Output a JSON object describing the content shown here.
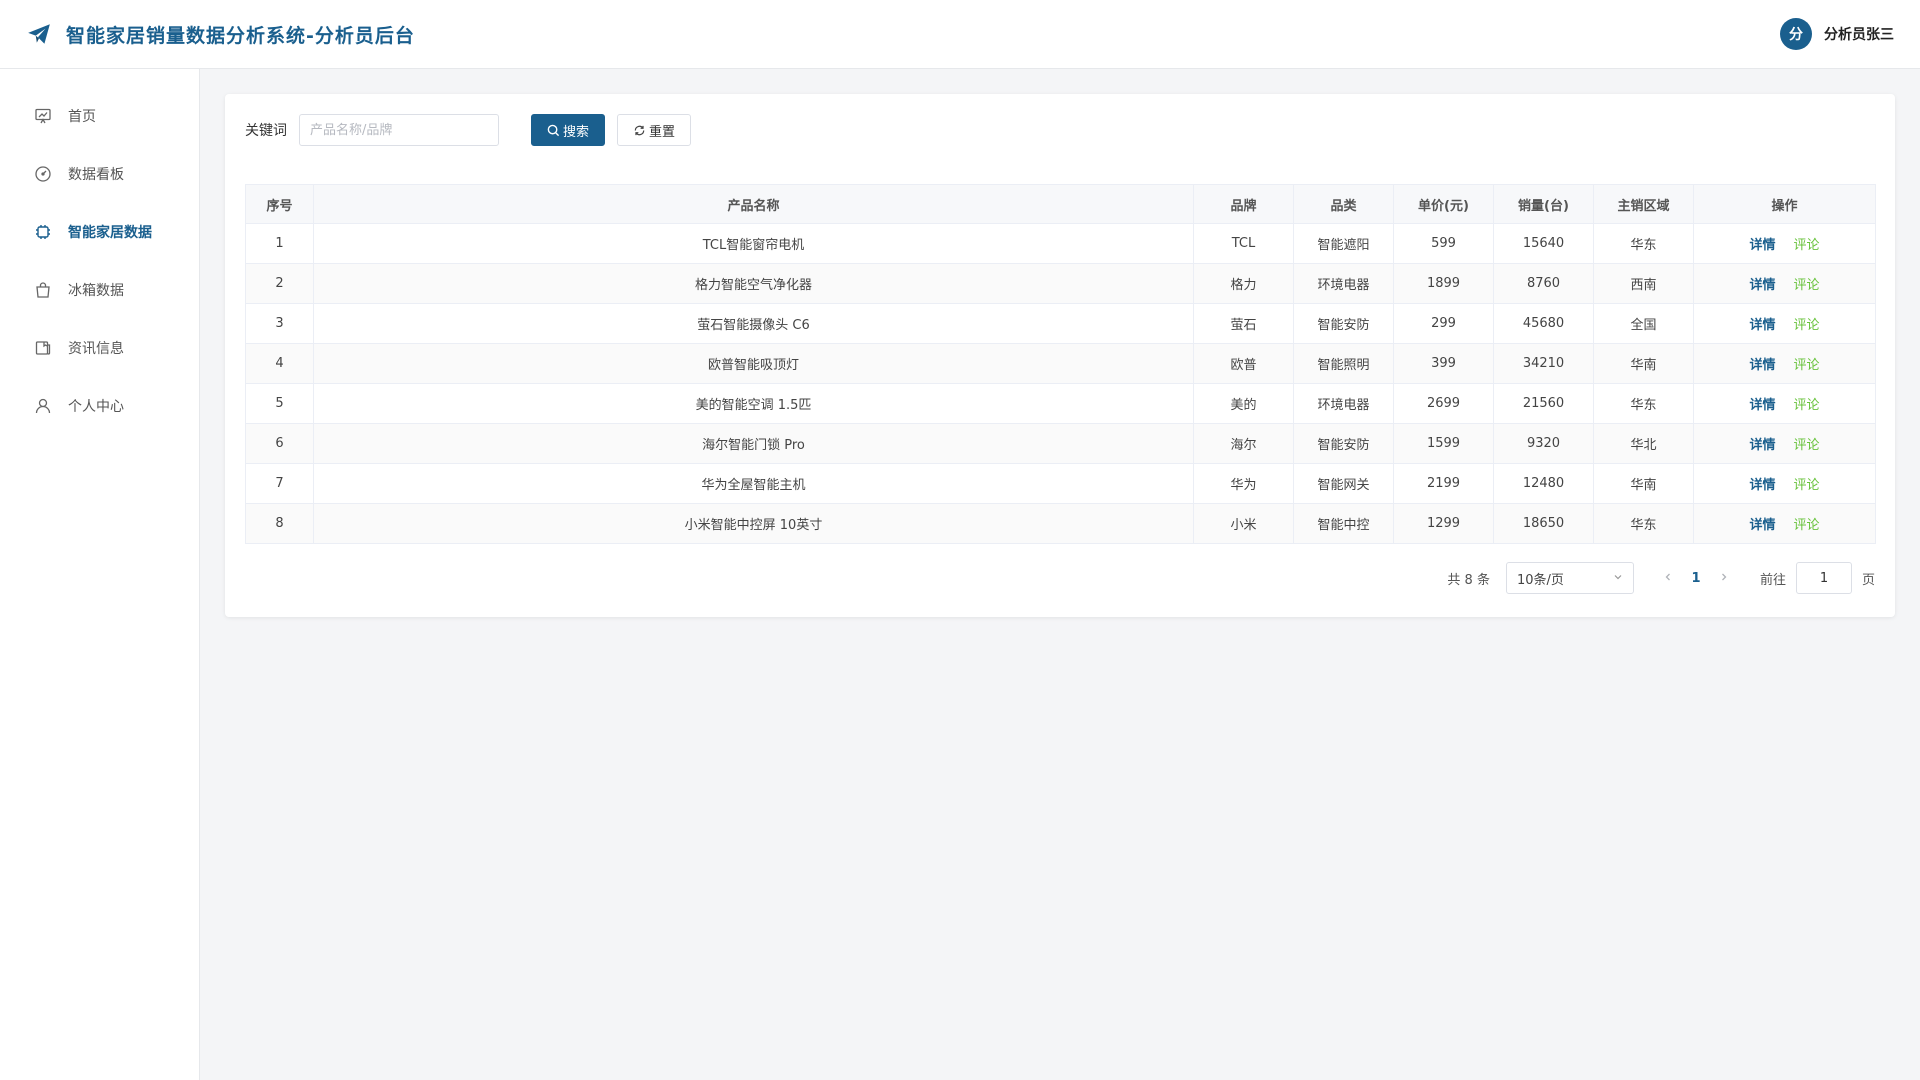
{
  "header": {
    "title": "智能家居销量数据分析系统-分析员后台",
    "avatar_text": "分",
    "user_name": "分析员张三"
  },
  "sidebar": {
    "items": [
      {
        "label": "首页",
        "icon": "presentation-chart-icon"
      },
      {
        "label": "数据看板",
        "icon": "gauge-icon"
      },
      {
        "label": "智能家居数据",
        "icon": "chip-icon",
        "active": true
      },
      {
        "label": "冰箱数据",
        "icon": "shopping-bag-icon"
      },
      {
        "label": "资讯信息",
        "icon": "news-icon"
      },
      {
        "label": "个人中心",
        "icon": "user-icon"
      }
    ]
  },
  "search": {
    "label": "关键词",
    "placeholder": "产品名称/品牌",
    "value": "",
    "search_button": "搜索",
    "reset_button": "重置"
  },
  "table": {
    "columns": [
      "序号",
      "产品名称",
      "品牌",
      "品类",
      "单价(元)",
      "销量(台)",
      "主销区域",
      "操作"
    ],
    "rows": [
      [
        "1",
        "TCL智能窗帘电机",
        "TCL",
        "智能遮阳",
        "599",
        "15640",
        "华东"
      ],
      [
        "2",
        "格力智能空气净化器",
        "格力",
        "环境电器",
        "1899",
        "8760",
        "西南"
      ],
      [
        "3",
        "萤石智能摄像头 C6",
        "萤石",
        "智能安防",
        "299",
        "45680",
        "全国"
      ],
      [
        "4",
        "欧普智能吸顶灯",
        "欧普",
        "智能照明",
        "399",
        "34210",
        "华南"
      ],
      [
        "5",
        "美的智能空调 1.5匹",
        "美的",
        "环境电器",
        "2699",
        "21560",
        "华东"
      ],
      [
        "6",
        "海尔智能门锁 Pro",
        "海尔",
        "智能安防",
        "1599",
        "9320",
        "华北"
      ],
      [
        "7",
        "华为全屋智能主机",
        "华为",
        "智能网关",
        "2199",
        "12480",
        "华南"
      ],
      [
        "8",
        "小米智能中控屏 10英寸",
        "小米",
        "智能中控",
        "1299",
        "18650",
        "华东"
      ]
    ],
    "op_detail": "详情",
    "op_comment": "评论"
  },
  "pagination": {
    "total_text": "共 8 条",
    "page_size": "10条/页",
    "current_page": "1",
    "goto_label": "前往",
    "goto_value": "1",
    "goto_suffix": "页"
  },
  "colors": {
    "primary": "#1a5f8e",
    "comment_green": "#67c23a"
  }
}
